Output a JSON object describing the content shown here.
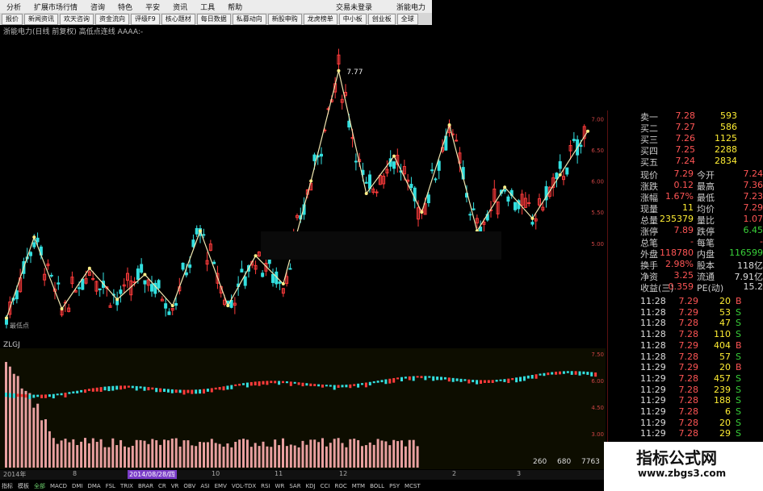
{
  "menu": [
    "分析",
    "扩展市场行情",
    "咨询",
    "特色",
    "平安",
    "资讯",
    "工具",
    "帮助"
  ],
  "menu_right": [
    "交易未登录",
    "浙能电力"
  ],
  "toolbar": [
    "报价",
    "新闻资讯",
    "欢天咨询",
    "资金流向",
    "评级F9",
    "核心题材",
    "每日数据",
    "私募动向",
    "新股申购",
    "龙虎榜单",
    "中小板",
    "创业板",
    "全球"
  ],
  "chart_title": "浙能电力(日线 前复权) 高低点连线 AAAA:-",
  "peak_label": "7.77",
  "low_label": "最低点",
  "sub_label": "ZLGJ",
  "volume_numbers": [
    "260",
    "680",
    "7763"
  ],
  "date_marks": [
    "2014年",
    "8",
    "2014/08/28/四",
    "10",
    "11",
    "12",
    "2",
    "3"
  ],
  "bottom_tabs": [
    "指标",
    "模板",
    "全部",
    "MACD",
    "DMI",
    "DMA",
    "FSL",
    "TRIX",
    "BRAR",
    "CR",
    "VR",
    "OBV",
    "ASI",
    "EMV",
    "VOL-TDX",
    "RSI",
    "WR",
    "SAR",
    "KDJ",
    "CCI",
    "ROC",
    "MTM",
    "BOLL",
    "PSY",
    "MCST"
  ],
  "order_book": [
    {
      "label": "卖一",
      "price": "7.28",
      "vol": "593"
    },
    {
      "label": "买二",
      "price": "7.27",
      "vol": "586"
    },
    {
      "label": "买三",
      "price": "7.26",
      "vol": "1125"
    },
    {
      "label": "买四",
      "price": "7.25",
      "vol": "2288"
    },
    {
      "label": "买五",
      "price": "7.24",
      "vol": "2834"
    }
  ],
  "stats": [
    {
      "l1": "现价",
      "v1": "7.29",
      "l2": "今开",
      "v2": "7.24"
    },
    {
      "l1": "涨跌",
      "v1": "0.12",
      "l2": "最高",
      "v2": "7.36"
    },
    {
      "l1": "涨幅",
      "v1": "1.67%",
      "l2": "最低",
      "v2": "7.23"
    },
    {
      "l1": "现量",
      "v1": "11",
      "l2": "均价",
      "v2": "7.29"
    },
    {
      "l1": "总量",
      "v1": "235379",
      "l2": "量比",
      "v2": "1.07"
    },
    {
      "l1": "涨停",
      "v1": "7.89",
      "l2": "跌停",
      "v2": "6.45"
    },
    {
      "l1": "总笔",
      "v1": "-",
      "l2": "每笔",
      "v2": "-"
    },
    {
      "l1": "外盘",
      "v1": "118780",
      "l2": "内盘",
      "v2": "116599"
    },
    {
      "l1": "换手",
      "v1": "2.98%",
      "l2": "股本",
      "v2": "118亿"
    },
    {
      "l1": "净资",
      "v1": "3.25",
      "l2": "流通",
      "v2": "7.91亿"
    },
    {
      "l1": "收益(三)",
      "v1": "0.359",
      "l2": "PE(动)",
      "v2": "15.2"
    }
  ],
  "ticks": [
    {
      "t": "11:28",
      "p": "7.29",
      "v": "20",
      "d": "B"
    },
    {
      "t": "11:28",
      "p": "7.29",
      "v": "53",
      "d": "S"
    },
    {
      "t": "11:28",
      "p": "7.28",
      "v": "47",
      "d": "S"
    },
    {
      "t": "11:28",
      "p": "7.28",
      "v": "110",
      "d": "S"
    },
    {
      "t": "11:28",
      "p": "7.29",
      "v": "404",
      "d": "B"
    },
    {
      "t": "11:28",
      "p": "7.28",
      "v": "57",
      "d": "S"
    },
    {
      "t": "11:29",
      "p": "7.29",
      "v": "20",
      "d": "B"
    },
    {
      "t": "11:29",
      "p": "7.28",
      "v": "457",
      "d": "S"
    },
    {
      "t": "11:29",
      "p": "7.28",
      "v": "239",
      "d": "S"
    },
    {
      "t": "11:29",
      "p": "7.28",
      "v": "188",
      "d": "S"
    },
    {
      "t": "11:29",
      "p": "7.28",
      "v": "6",
      "d": "S"
    },
    {
      "t": "11:29",
      "p": "7.28",
      "v": "20",
      "d": "S"
    },
    {
      "t": "11:29",
      "p": "7.28",
      "v": "29",
      "d": "S"
    }
  ],
  "price_axis": [
    "8.00",
    "7.50",
    "7.00",
    "6.50",
    "6.00",
    "5.50",
    "5.00"
  ],
  "sub_axis": [
    "7.50",
    "6.00",
    "4.50",
    "3.00"
  ],
  "watermark": {
    "title": "指标公式网",
    "url": "www.zbgs3.com"
  },
  "zigzag_prices": [
    3.8,
    5.1,
    3.95,
    4.6,
    4.1,
    4.5,
    4.0,
    5.2,
    4.0,
    4.8,
    4.35,
    6.0,
    7.77,
    5.8,
    6.4,
    5.5,
    6.9,
    5.2,
    5.9,
    5.4,
    6.1,
    6.8
  ],
  "colors": {
    "up": "#ff3b3b",
    "down": "#33e0e0",
    "zigzag": "#f0e6b0",
    "accent_green": "#39d139"
  }
}
